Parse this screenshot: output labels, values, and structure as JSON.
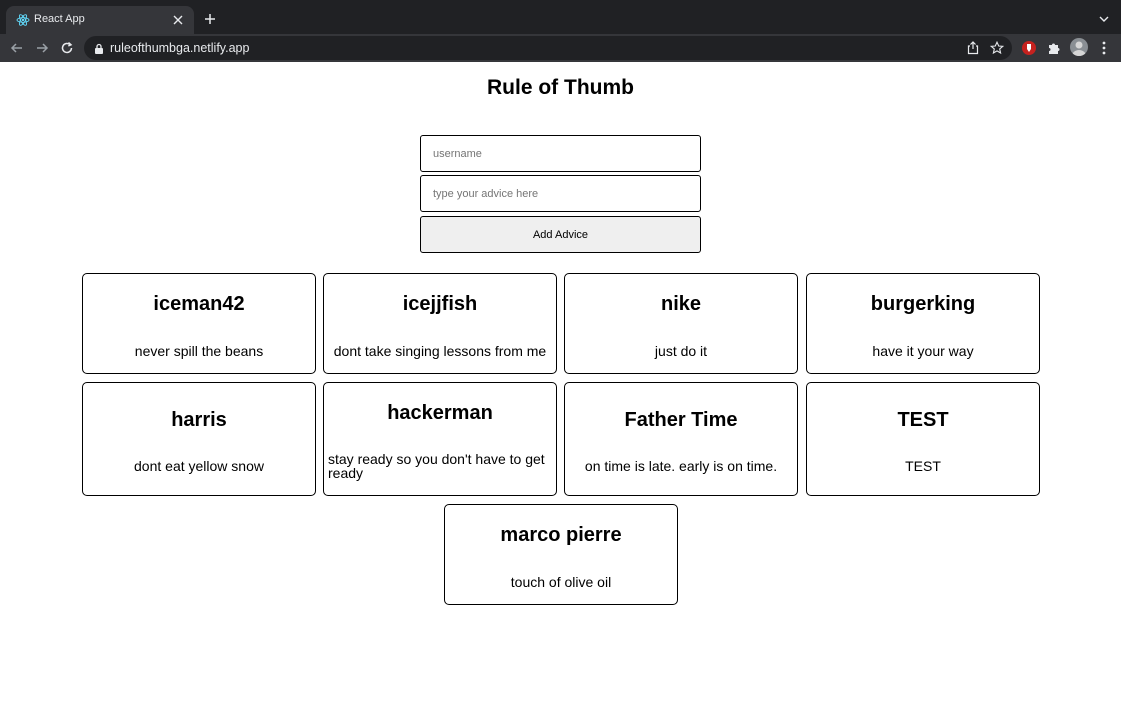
{
  "browser": {
    "tab_title": "React App",
    "url": "ruleofthumbga.netlify.app"
  },
  "page": {
    "title": "Rule of Thumb",
    "form": {
      "username_placeholder": "username",
      "advice_placeholder": "type your advice here",
      "submit_label": "Add Advice"
    },
    "cards": [
      {
        "name": "iceman42",
        "advice": "never spill the beans"
      },
      {
        "name": "icejjfish",
        "advice": "dont take singing lessons from me"
      },
      {
        "name": "nike",
        "advice": "just do it"
      },
      {
        "name": "burgerking",
        "advice": "have it your way"
      },
      {
        "name": "harris",
        "advice": "dont eat yellow snow"
      },
      {
        "name": "hackerman",
        "advice": "stay ready so you don't have to get ready"
      },
      {
        "name": "Father Time",
        "advice": "on time is late. early is on time."
      },
      {
        "name": "TEST",
        "advice": "TEST"
      },
      {
        "name": "marco pierre",
        "advice": "touch of olive oil"
      }
    ]
  },
  "colors": {
    "chrome_dark": "#202124",
    "chrome_toolbar": "#35363a",
    "chrome_text": "#e8eaed",
    "button_bg": "#efefef"
  }
}
